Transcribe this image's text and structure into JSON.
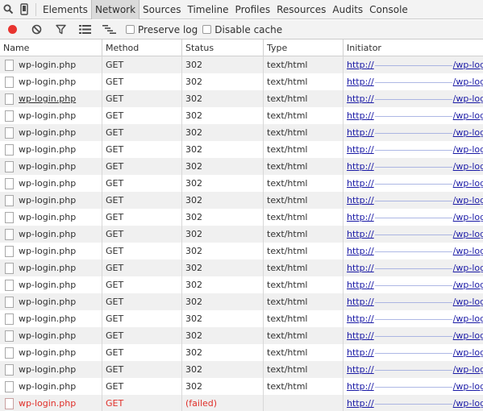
{
  "devtools": {
    "tabs": [
      {
        "label": "Elements",
        "active": false
      },
      {
        "label": "Network",
        "active": true
      },
      {
        "label": "Sources",
        "active": false
      },
      {
        "label": "Timeline",
        "active": false
      },
      {
        "label": "Profiles",
        "active": false
      },
      {
        "label": "Resources",
        "active": false
      },
      {
        "label": "Audits",
        "active": false
      },
      {
        "label": "Console",
        "active": false
      }
    ],
    "icons": [
      "search-icon",
      "device-mode-icon"
    ]
  },
  "toolbar": {
    "record_icon": "record-icon",
    "clear_icon": "clear-icon",
    "filter_icon": "filter-icon",
    "list_view_icon": "large-rows-icon",
    "overview_icon": "overview-icon",
    "preserve_log_label": "Preserve log",
    "disable_cache_label": "Disable cache",
    "record_color": "#e8342f"
  },
  "table": {
    "columns": [
      "Name",
      "Method",
      "Status",
      "Type",
      "Initiator"
    ],
    "initiator_prefix": "http://",
    "initiator_suffix": "/wp-login.php",
    "rows": [
      {
        "name": "wp-login.php",
        "method": "GET",
        "status": "302",
        "type": "text/html"
      },
      {
        "name": "wp-login.php",
        "method": "GET",
        "status": "302",
        "type": "text/html"
      },
      {
        "name": "wp-login.php",
        "method": "GET",
        "status": "302",
        "type": "text/html",
        "underline": true
      },
      {
        "name": "wp-login.php",
        "method": "GET",
        "status": "302",
        "type": "text/html"
      },
      {
        "name": "wp-login.php",
        "method": "GET",
        "status": "302",
        "type": "text/html"
      },
      {
        "name": "wp-login.php",
        "method": "GET",
        "status": "302",
        "type": "text/html"
      },
      {
        "name": "wp-login.php",
        "method": "GET",
        "status": "302",
        "type": "text/html"
      },
      {
        "name": "wp-login.php",
        "method": "GET",
        "status": "302",
        "type": "text/html"
      },
      {
        "name": "wp-login.php",
        "method": "GET",
        "status": "302",
        "type": "text/html"
      },
      {
        "name": "wp-login.php",
        "method": "GET",
        "status": "302",
        "type": "text/html"
      },
      {
        "name": "wp-login.php",
        "method": "GET",
        "status": "302",
        "type": "text/html"
      },
      {
        "name": "wp-login.php",
        "method": "GET",
        "status": "302",
        "type": "text/html"
      },
      {
        "name": "wp-login.php",
        "method": "GET",
        "status": "302",
        "type": "text/html"
      },
      {
        "name": "wp-login.php",
        "method": "GET",
        "status": "302",
        "type": "text/html"
      },
      {
        "name": "wp-login.php",
        "method": "GET",
        "status": "302",
        "type": "text/html"
      },
      {
        "name": "wp-login.php",
        "method": "GET",
        "status": "302",
        "type": "text/html"
      },
      {
        "name": "wp-login.php",
        "method": "GET",
        "status": "302",
        "type": "text/html"
      },
      {
        "name": "wp-login.php",
        "method": "GET",
        "status": "302",
        "type": "text/html"
      },
      {
        "name": "wp-login.php",
        "method": "GET",
        "status": "302",
        "type": "text/html"
      },
      {
        "name": "wp-login.php",
        "method": "GET",
        "status": "302",
        "type": "text/html"
      },
      {
        "name": "wp-login.php",
        "method": "GET",
        "status": "(failed)",
        "type": "",
        "failed": true
      }
    ]
  }
}
